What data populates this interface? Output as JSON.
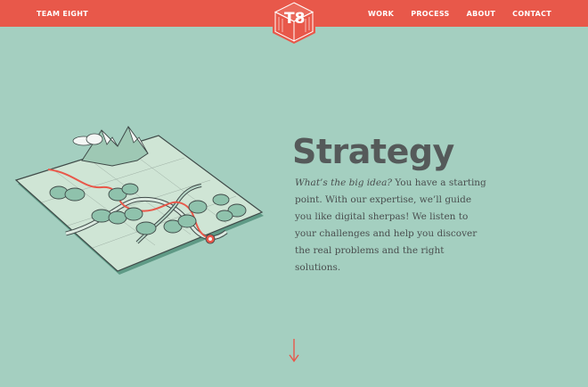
{
  "header": {
    "brand": "TEAM EIGHT",
    "logo_text": "T8",
    "nav": [
      "WORK",
      "PROCESS",
      "ABOUT",
      "CONTACT"
    ]
  },
  "main": {
    "title": "Strategy",
    "lead": "What’s the big idea?",
    "body": " You have a starting point. With our expertise, we’ll guide you like digital sherpas! We listen to your challenges and help you discover the real problems and the right solutions."
  },
  "colors": {
    "background": "#a4cfc0",
    "accent": "#e8584a",
    "heading": "#555a5a"
  },
  "icons": [
    "t8-logo-icon",
    "map-illustration",
    "down-arrow-icon"
  ]
}
